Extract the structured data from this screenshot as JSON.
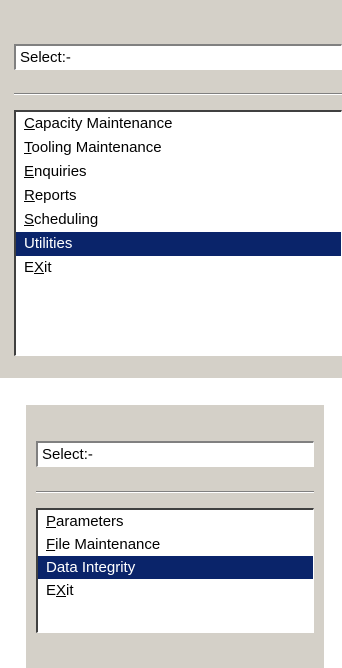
{
  "menus": [
    {
      "select_label": "Select:-",
      "selected": "Utilities",
      "items": [
        {
          "label": "Capacity Maintenance",
          "hotkey": "C"
        },
        {
          "label": "Tooling Maintenance",
          "hotkey": "T"
        },
        {
          "label": "Enquiries",
          "hotkey": "E"
        },
        {
          "label": "Reports",
          "hotkey": "R"
        },
        {
          "label": "Scheduling",
          "hotkey": "S"
        },
        {
          "label": "Utilities",
          "hotkey": ""
        },
        {
          "label": "EXit",
          "hotkey": "X"
        }
      ]
    },
    {
      "select_label": "Select:-",
      "selected": "Data Integrity",
      "items": [
        {
          "label": "Parameters",
          "hotkey": "P"
        },
        {
          "label": "File Maintenance",
          "hotkey": "F"
        },
        {
          "label": "Data Integrity",
          "hotkey": ""
        },
        {
          "label": "EXit",
          "hotkey": "X"
        }
      ]
    }
  ],
  "colors": {
    "face": "#d4d0c8",
    "highlight": "#0a246a",
    "highlight_text": "#ffffff"
  }
}
